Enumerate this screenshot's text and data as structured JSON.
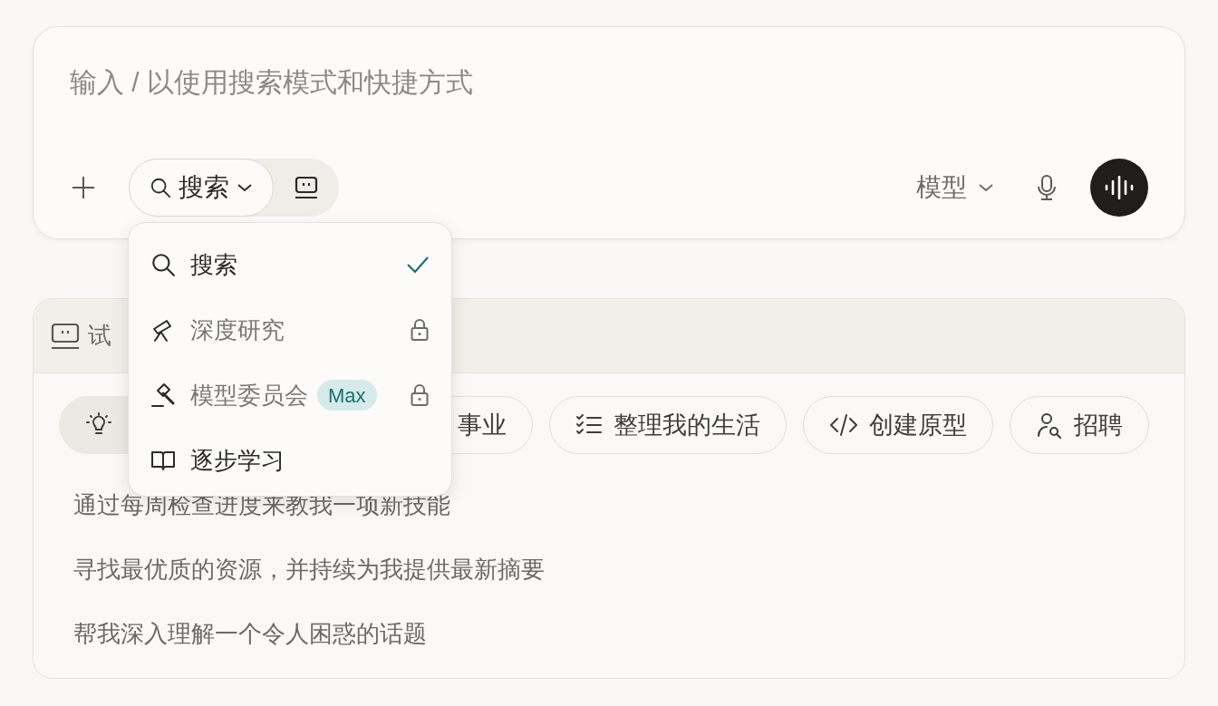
{
  "composer": {
    "placeholder": "输入 / 以使用搜索模式和快捷方式",
    "mode_button": {
      "label": "搜索"
    },
    "model_button": {
      "label": "模型"
    }
  },
  "mode_menu": {
    "items": [
      {
        "label": "搜索",
        "selected": true,
        "locked": false
      },
      {
        "label": "深度研究",
        "selected": false,
        "locked": true
      },
      {
        "label": "模型委员会",
        "badge": "Max",
        "selected": false,
        "locked": true
      },
      {
        "label": "逐步学习",
        "selected": false,
        "locked": false
      }
    ]
  },
  "try_panel": {
    "title": "试",
    "chips": [
      {
        "selected": true
      },
      {
        "label": "事业",
        "selected": false
      },
      {
        "label": "整理我的生活",
        "selected": false
      },
      {
        "label": "创建原型",
        "selected": false
      },
      {
        "label": "招聘",
        "selected": false
      }
    ],
    "suggestions": [
      "通过每周检查进度来教我一项新技能",
      "寻找最优质的资源，并持续为我提供最新摘要",
      "帮我深入理解一个令人困惑的话题"
    ]
  }
}
